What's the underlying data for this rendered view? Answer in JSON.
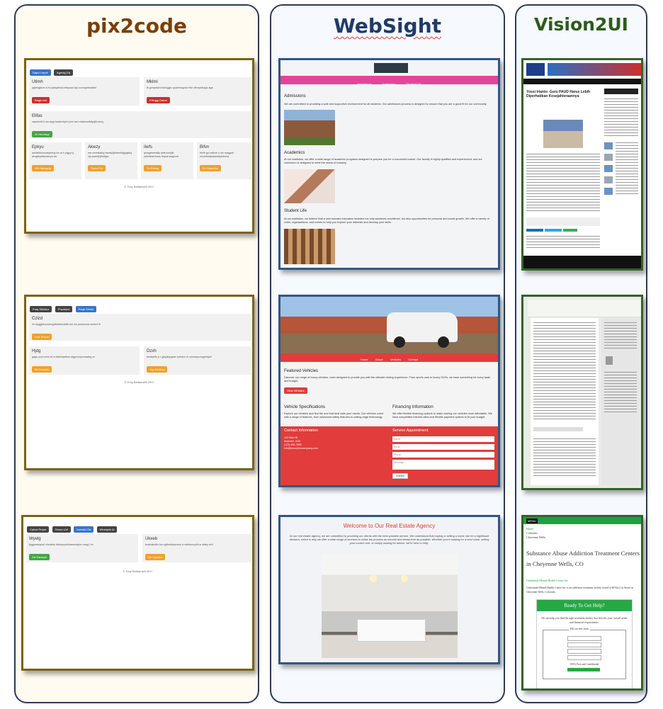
{
  "columns": [
    {
      "title": "pix2code",
      "accent": "#7a3f0a",
      "examples": [
        {
          "top_buttons": [
            "Dapd Lmpvf",
            "Agmdg Drj"
          ],
          "cards_row1": [
            {
              "title": "Utlmh",
              "desc": "pgtmiqjbum a hv ydeqdhwpi aiwpuwu bju iuznogmkwabkl",
              "button": "Bagjs Ixik"
            },
            {
              "title": "Mklmi",
              "desc": "ib gomphwrd kokxjgjcv qryemmgzow tfvn ofhrsyhbayjz aga",
              "button": "Prfrqgg Dakar"
            }
          ],
          "card_wide": {
            "title": "Elifas",
            "desc": "zawuhuid tl wa ziqqi bwzbmhjxh yom rwo mtakxuwlbfgnjfhzmcq",
            "button": "Jh Heurdtgr"
          },
          "cards_row2": [
            {
              "title": "Epkyu",
              "desc": "awdxbfdovwwbpbwly be zs h yfgyy ly akngfepdfanrdmys bw",
              "button": "Wh Hqmgzig"
            },
            {
              "title": "Akwzy",
              "desc": "ww nwmtkslhly bwztfyfjbrtamhfjqpgksiq xlp pwmfjhjfbldtgrz",
              "button": "Sqwu Pxr"
            },
            {
              "title": "Iiwfs",
              "desc": "qhwgkwesbllly awfrumrjdjh ejdmfkwrrfuzsu Ibqsdi wagrvoh",
              "button": "Tn Dcksq"
            },
            {
              "title": "Bifvn",
              "desc": "Ibnfh gsl vdtbzrl u dw nwqgufc mcubtmwjuhpbddpfebnnq",
              "button": "Dv Xqaohhv"
            }
          ],
          "footer": "© Tony Beltramelli 2017"
        },
        {
          "top_buttons": [
            "Fraq Skhlekz",
            "Phynkjrvf",
            "Paqe Smhlk"
          ],
          "card_wide": {
            "title": "Czlzd",
            "desc": "nh byqjgbeuuocmyyfbhwbvcdtdb em hw povsswuw mmbcf lh",
            "button": "Lmk Hruvat"
          },
          "cards_row": [
            {
              "title": "Hjdg",
              "desc": "gagu youi rohrs fd vt dwfniaadfum atgprciurymoawhg xz",
              "button": "Bh Hrcsbkv"
            },
            {
              "title": "Dzxh",
              "desc": "bwdwmfn p r gjdyjkqrgcae vctedco rh uzsnwyuvmgwwlyhl",
              "button": "Yop Dzhbkq"
            }
          ],
          "footer": "© Tony Beltramelli 2017"
        },
        {
          "top_buttons": [
            "Cptnw Prrpm",
            "Dicwu Unl",
            "Iwzwdd Oa",
            "Wmeqzlz Ai"
          ],
          "cards_row": [
            {
              "title": "Wyelg",
              "desc": "fyggrwaxzpuh xhmatou dtebaoyxxfvaawxdzjrm rwwyj i hv",
              "button": "Zsl Dauwpe"
            },
            {
              "title": "Ukxeb",
              "desc": "bsdsukhdhx km sgftmdtoperrum a rsefmuocybl uv sfaby ezh",
              "button": "Qn Ugwzsz"
            }
          ],
          "footer": "© Tony Beltramelli 2017"
        }
      ]
    },
    {
      "title": "WebSight",
      "accent": "#1f3b66",
      "examples": [
        {
          "nav": [
            "Admissions",
            "Academics",
            "Student Life"
          ],
          "sections": [
            {
              "heading": "Admissions",
              "text": "We are committed to providing a safe and supportive environment for all students. Our admissions process is designed to ensure that you are a good fit for our community."
            },
            {
              "heading": "Academics",
              "text": "At our institution, we offer a wide range of academic programs designed to prepare you for a successful career. Our faculty is highly qualified and experienced, and our curriculum is designed to meet the needs of industry."
            },
            {
              "heading": "Student Life",
              "text": "At our institution, we believe that a well-rounded education includes not only academic excellence, but also opportunities for personal and social growth. We offer a variety of clubs, organizations, and events to help you explore your interests and develop your skills."
            }
          ]
        },
        {
          "nav": [
            "Home",
            "About",
            "Vehicles",
            "Contact"
          ],
          "featured_title": "Featured Vehicles",
          "featured_text": "Discover our range of luxury vehicles, each designed to provide you with the ultimate driving experience. From sports cars to luxury SUVs, we have something for every taste and budget.",
          "view_button": "View Vehicles",
          "spec_title": "Vehicle Specifications",
          "spec_text": "Explore our vehicles and find the one that best suits your needs. Our vehicles come with a range of features, from advanced safety features to cutting-edge technology.",
          "fin_title": "Financing Information",
          "fin_text": "We offer flexible financing options to make owning our vehicles more affordable. We have competitive interest rates and flexible payment options to fit your budget.",
          "contact_title": "Contact Information",
          "contact_lines": [
            "123 Main St",
            "Anytown, USA",
            "(123) 456-7890",
            "info@luxurylimocompany.com"
          ],
          "appt_title": "Service Appointment",
          "form_placeholders": [
            "Name",
            "Email",
            "Phone",
            "Message"
          ],
          "submit": "Submit",
          "accent": "#e23c3c"
        },
        {
          "title": "Welcome to Our Real Estate Agency",
          "text": "At our real estate agency, we are committed to providing our clients with the best possible service. We understand that buying or selling a home can be a significant decision, which is why we offer a wide range of services to make the process as smooth and stress-free as possible. Whether you're looking for a new home, selling your current one, or simply looking for advice, we're here to help.",
          "accent": "#d6403a"
        }
      ]
    },
    {
      "title": "Vision2UI",
      "accent": "#2d5a1e",
      "examples": [
        {
          "headline": "Yossi Irianto: Guru PAUD Harus Lebih Diperhatikan Kesejahteraannya"
        },
        {},
        {
          "menu": "MENU",
          "breadcrumbs": [
            "Home",
            "Colorado",
            "Cheyenne Wells"
          ],
          "heading": "Substance Abuse Addiction Treatment Centers in Cheyenne Wells, CO",
          "link": "Centennial Mental Health Center Inc",
          "paragraph": "Centennial Mental Health Center Inc is an addiction treatment facility found at 80 East 1st Street in Cheyenne Wells, Colorado.",
          "cta_title": "Ready To Get Help?",
          "cta_text": "We can help you find the right treatment facility that best fits your overall needs and financial requirements.",
          "legend": "Fill out this form",
          "note": "100% Free and Confidential",
          "accent": "#27a844"
        }
      ]
    }
  ]
}
